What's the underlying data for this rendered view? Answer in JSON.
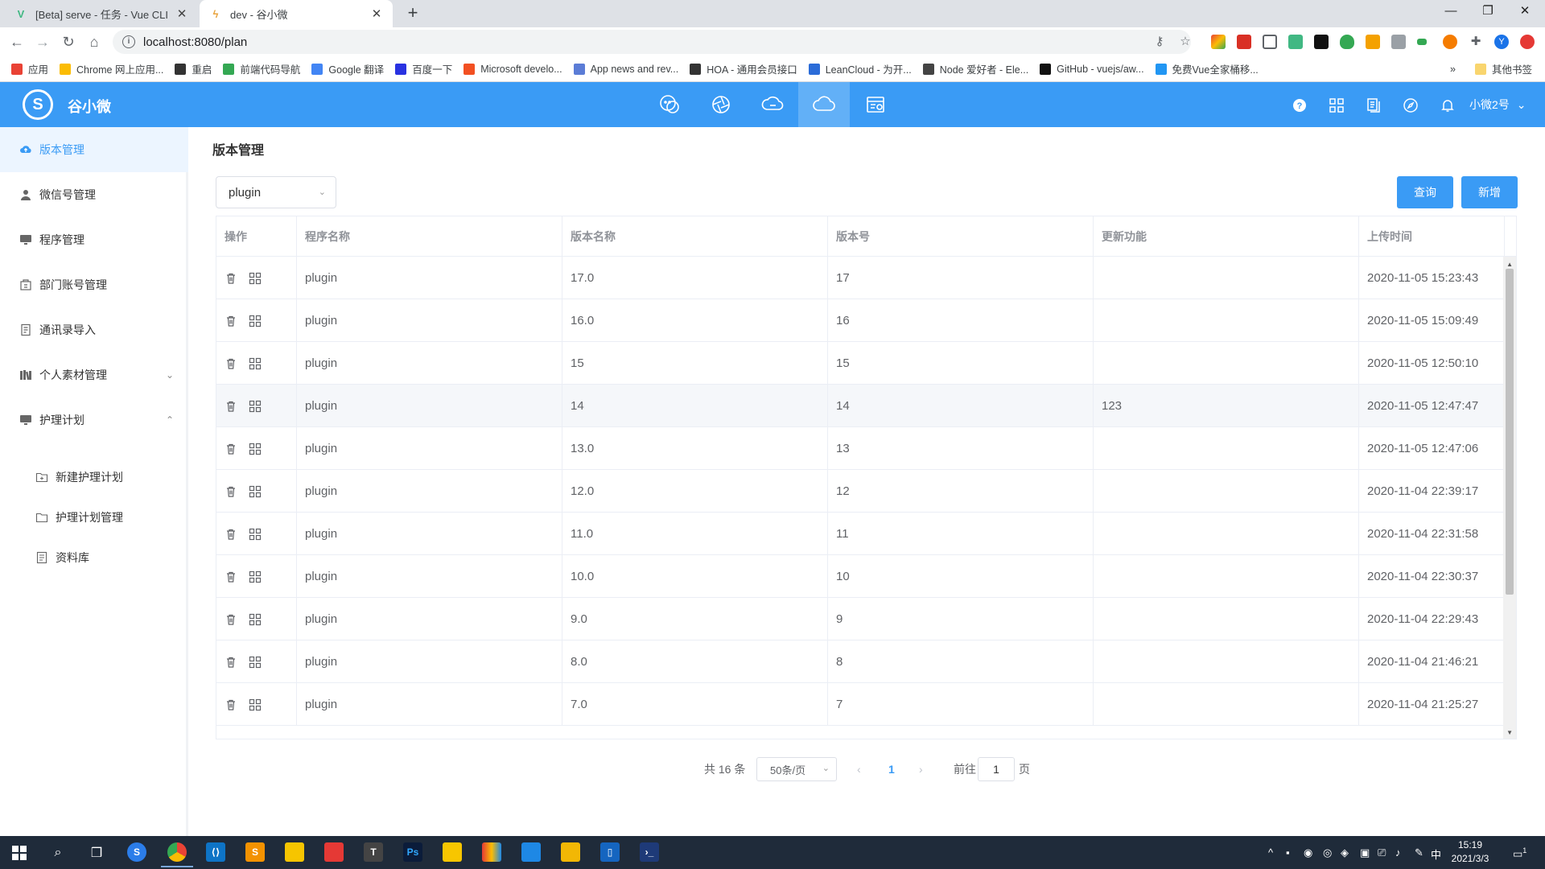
{
  "browser": {
    "tabs": [
      {
        "title": "[Beta] serve - 任务 - Vue CLI",
        "favicon": "vue-icon",
        "active": false
      },
      {
        "title": "dev - 谷小微",
        "favicon": "bolt-icon",
        "active": true
      }
    ],
    "url": "localhost:8080/plan",
    "bookmarks": [
      {
        "label": "应用",
        "color": "#e94235"
      },
      {
        "label": "Chrome 网上应用...",
        "color": "#fbbc04"
      },
      {
        "label": "重启",
        "color": "#333333"
      },
      {
        "label": "前端代码导航",
        "color": "#34a853"
      },
      {
        "label": "Google 翻译",
        "color": "#4285f4"
      },
      {
        "label": "百度一下",
        "color": "#2932e1"
      },
      {
        "label": "Microsoft develo...",
        "color": "#f25022"
      },
      {
        "label": "App news and rev...",
        "color": "#5b7cd6"
      },
      {
        "label": "HOA - 通用会员接口",
        "color": "#333333"
      },
      {
        "label": "LeanCloud - 为开...",
        "color": "#2b6cd8"
      },
      {
        "label": "Node 爱好者 - Ele...",
        "color": "#444444"
      },
      {
        "label": "GitHub - vuejs/aw...",
        "color": "#111111"
      },
      {
        "label": "免费Vue全家桶移...",
        "color": "#2196f3"
      }
    ],
    "bookmarks_more": "»",
    "other_bookmarks": "其他书签"
  },
  "app": {
    "brand": "谷小微",
    "user": "小微2号",
    "accent": "#3a9bf5"
  },
  "sidebar": {
    "items": [
      {
        "label": "版本管理",
        "icon": "cloud-upload-icon",
        "active": true
      },
      {
        "label": "微信号管理",
        "icon": "user-icon"
      },
      {
        "label": "程序管理",
        "icon": "monitor-icon"
      },
      {
        "label": "部门账号管理",
        "icon": "building-icon"
      },
      {
        "label": "通讯录导入",
        "icon": "notebook-icon"
      },
      {
        "label": "个人素材管理",
        "icon": "library-icon",
        "expand": "down"
      },
      {
        "label": "护理计划",
        "icon": "monitor-icon",
        "expand": "up"
      }
    ],
    "subitems": [
      {
        "label": "新建护理计划",
        "icon": "folder-add-icon"
      },
      {
        "label": "护理计划管理",
        "icon": "folder-icon"
      },
      {
        "label": "资料库",
        "icon": "document-icon"
      }
    ]
  },
  "main": {
    "title": "版本管理",
    "select_value": "plugin",
    "query_button": "查询",
    "add_button": "新增",
    "columns": [
      "操作",
      "程序名称",
      "版本名称",
      "版本号",
      "更新功能",
      "上传时间"
    ],
    "rows": [
      {
        "name": "plugin",
        "version_name": "17.0",
        "version_no": "17",
        "features": "",
        "time": "2020-11-05 15:23:43"
      },
      {
        "name": "plugin",
        "version_name": "16.0",
        "version_no": "16",
        "features": "",
        "time": "2020-11-05 15:09:49"
      },
      {
        "name": "plugin",
        "version_name": "15",
        "version_no": "15",
        "features": "",
        "time": "2020-11-05 12:50:10"
      },
      {
        "name": "plugin",
        "version_name": "14",
        "version_no": "14",
        "features": "123",
        "time": "2020-11-05 12:47:47"
      },
      {
        "name": "plugin",
        "version_name": "13.0",
        "version_no": "13",
        "features": "",
        "time": "2020-11-05 12:47:06"
      },
      {
        "name": "plugin",
        "version_name": "12.0",
        "version_no": "12",
        "features": "",
        "time": "2020-11-04 22:39:17"
      },
      {
        "name": "plugin",
        "version_name": "11.0",
        "version_no": "11",
        "features": "",
        "time": "2020-11-04 22:31:58"
      },
      {
        "name": "plugin",
        "version_name": "10.0",
        "version_no": "10",
        "features": "",
        "time": "2020-11-04 22:30:37"
      },
      {
        "name": "plugin",
        "version_name": "9.0",
        "version_no": "9",
        "features": "",
        "time": "2020-11-04 22:29:43"
      },
      {
        "name": "plugin",
        "version_name": "8.0",
        "version_no": "8",
        "features": "",
        "time": "2020-11-04 21:46:21"
      },
      {
        "name": "plugin",
        "version_name": "7.0",
        "version_no": "7",
        "features": "",
        "time": "2020-11-04 21:25:27"
      }
    ],
    "highlighted_row": 3,
    "pagination": {
      "total": "共 16 条",
      "page_size": "50条/页",
      "current_page": "1",
      "goto_label": "前往",
      "goto_value": "1",
      "page_suffix": "页"
    }
  },
  "taskbar": {
    "time": "15:19",
    "date": "2021/3/3",
    "ime": "中",
    "notifications": "1"
  }
}
